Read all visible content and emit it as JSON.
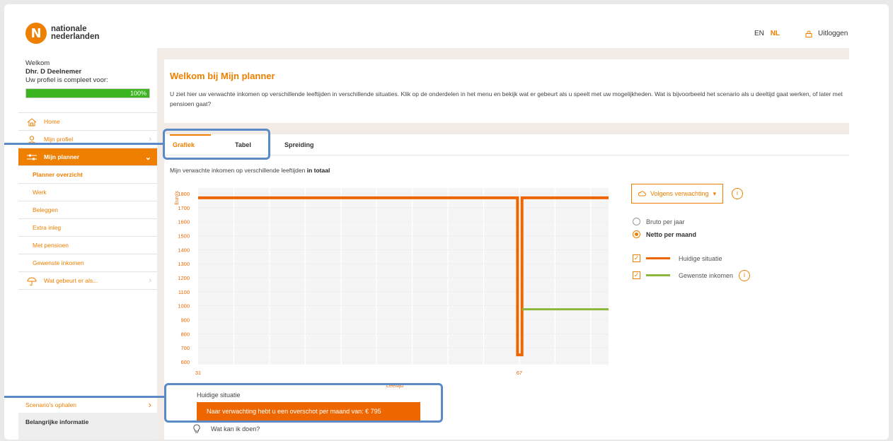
{
  "header": {
    "logo_line1": "nationale",
    "logo_line2": "nederlanden",
    "lang_en": "EN",
    "lang_nl": "NL",
    "logout": "Uitloggen"
  },
  "sidebar": {
    "welcome": "Welkom",
    "name": "Dhr. D Deelnemer",
    "profile_text": "Uw profiel is compleet voor:",
    "progress_label": "100%",
    "progress_value": 1.0,
    "items": [
      {
        "label": "Home",
        "icon": "home-icon"
      },
      {
        "label": "Mijn profiel",
        "icon": "person-icon"
      },
      {
        "label": "Mijn planner",
        "icon": "sliders-icon"
      }
    ],
    "sub_items": [
      "Planner overzicht",
      "Werk",
      "Beleggen",
      "Extra inleg",
      "Met pensioen",
      "Gewenste inkomen"
    ],
    "what_if": "Wat gebeurt er als...",
    "scenarios": "Scenario's ophalen",
    "important": "Belangrijke informatie"
  },
  "main": {
    "title": "Welkom bij Mijn planner",
    "intro": "U ziet hier uw verwachte inkomen op verschillende leeftijden in verschillende situaties. Klik op de onderdelen in het menu en bekijk wat er gebeurt als u speelt met uw mogelijkheden. Wat is bijvoorbeeld het scenario als u deeltijd gaat werken, of later met pensioen gaat?",
    "tabs": [
      "Grafiek",
      "Tabel",
      "Spreiding"
    ],
    "caption_prefix": "Mijn verwachte inkomen op verschillende leeftijden",
    "caption_bold": "in totaal",
    "dropdown": "Volgens verwachting",
    "radio_gross": "Bruto per jaar",
    "radio_net": "Netto per maand",
    "legend_current": "Huidige situatie",
    "legend_desired": "Gewenste inkomen",
    "result_label": "Huidige situatie",
    "result_text": "Naar verwachting hebt u een overschot per maand van: € 795",
    "what_can": "Wat kan ik doen?"
  },
  "colors": {
    "accent": "#ee7f00",
    "current": "#ee6600",
    "desired": "#8bb83a",
    "highlight": "#5b8ac6"
  },
  "chart_data": {
    "type": "line",
    "ylabel": "Euro's",
    "xlabel": "Leeftijd",
    "yticks": [
      600,
      700,
      800,
      900,
      1000,
      1100,
      1200,
      1300,
      1400,
      1500,
      1600,
      1700,
      1800
    ],
    "xtick_labels": [
      "31",
      "67"
    ],
    "ylim": [
      580,
      1840
    ],
    "xlim": [
      31,
      77
    ],
    "grid": true,
    "series": [
      {
        "name": "Huidige situatie",
        "points": [
          [
            31,
            1770
          ],
          [
            66.8,
            1770
          ],
          [
            66.8,
            650
          ],
          [
            67.3,
            650
          ],
          [
            67.3,
            1770
          ],
          [
            77,
            1770
          ]
        ]
      },
      {
        "name": "Gewenste inkomen",
        "points": [
          [
            67.3,
            975
          ],
          [
            77,
            975
          ]
        ]
      }
    ]
  }
}
